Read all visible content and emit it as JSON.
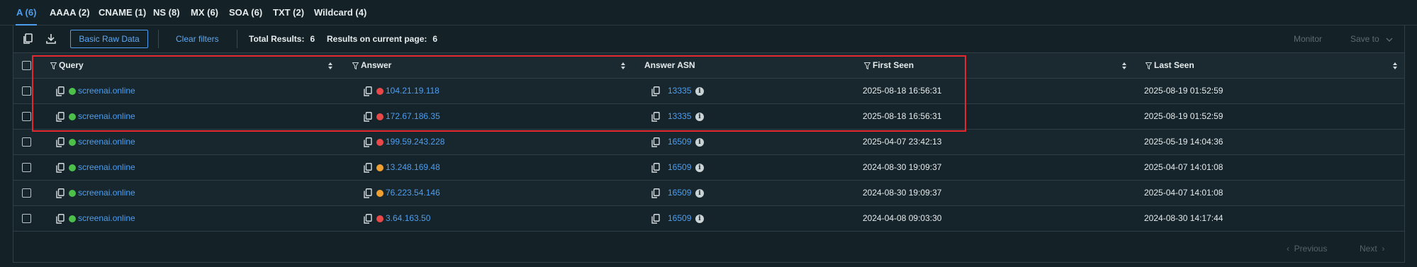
{
  "tabs": [
    {
      "label": "A (6)",
      "active": true
    },
    {
      "label": "AAAA (2)"
    },
    {
      "label": "CNAME (1)"
    },
    {
      "label": "NS (8)"
    },
    {
      "label": "MX (6)"
    },
    {
      "label": "SOA (6)"
    },
    {
      "label": "TXT (2)"
    },
    {
      "label": "Wildcard (4)"
    }
  ],
  "toolbar": {
    "copy_icon": "copy-icon",
    "download_icon": "download-icon",
    "basic_raw_data_label": "Basic Raw Data",
    "clear_filters_label": "Clear filters",
    "total_results_label": "Total Results:",
    "total_results_value": "6",
    "current_page_label": "Results on current page:",
    "current_page_value": "6",
    "monitor_label": "Monitor",
    "save_to_label": "Save to"
  },
  "columns": {
    "query": "Query",
    "answer": "Answer",
    "answer_asn": "Answer ASN",
    "first_seen": "First Seen",
    "last_seen": "Last Seen"
  },
  "rows": [
    {
      "query": "screenai.online",
      "answer": "104.21.19.118",
      "answer_status": "red",
      "asn": "13335",
      "first_seen": "2025-08-18 16:56:31",
      "last_seen": "2025-08-19 01:52:59"
    },
    {
      "query": "screenai.online",
      "answer": "172.67.186.35",
      "answer_status": "red",
      "asn": "13335",
      "first_seen": "2025-08-18 16:56:31",
      "last_seen": "2025-08-19 01:52:59"
    },
    {
      "query": "screenai.online",
      "answer": "199.59.243.228",
      "answer_status": "red",
      "asn": "16509",
      "first_seen": "2025-04-07 23:42:13",
      "last_seen": "2025-05-19 14:04:36"
    },
    {
      "query": "screenai.online",
      "answer": "13.248.169.48",
      "answer_status": "orange",
      "asn": "16509",
      "first_seen": "2024-08-30 19:09:37",
      "last_seen": "2025-04-07 14:01:08"
    },
    {
      "query": "screenai.online",
      "answer": "76.223.54.146",
      "answer_status": "orange",
      "asn": "16509",
      "first_seen": "2024-08-30 19:09:37",
      "last_seen": "2025-04-07 14:01:08"
    },
    {
      "query": "screenai.online",
      "answer": "3.64.163.50",
      "answer_status": "red",
      "asn": "16509",
      "first_seen": "2024-04-08 09:03:30",
      "last_seen": "2024-08-30 14:17:44"
    }
  ],
  "pagination": {
    "previous_label": "Previous",
    "next_label": "Next"
  },
  "colors": {
    "accent": "#4e9ef0",
    "query_status": "#4cc04a",
    "red": "#e84848",
    "orange": "#f0a030",
    "highlight": "#e5282f"
  }
}
